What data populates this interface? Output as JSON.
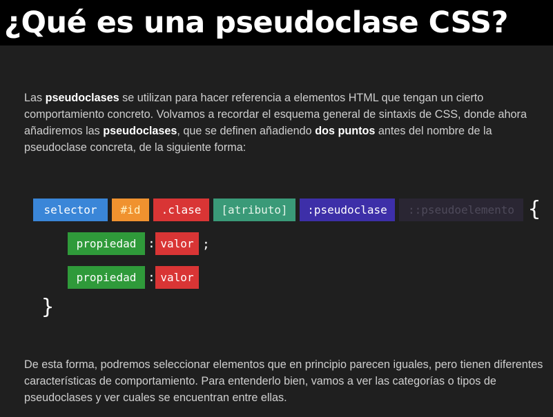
{
  "title": "¿Qué es una pseudoclase CSS?",
  "intro": {
    "t1": "Las ",
    "b1": "pseudoclases",
    "t2": " se utilizan para hacer referencia a elementos HTML que tengan un cierto comportamiento concreto. Volvamos a recordar el esquema general de sintaxis de CSS, donde ahora añadiremos las ",
    "b2": "pseudoclases",
    "t3": ", que se definen añadiendo ",
    "b3": "dos puntos",
    "t4": " antes del nombre de la pseudoclase concreta, de la siguiente forma:"
  },
  "syntax": {
    "tokens": {
      "selector": "selector",
      "id": "#id",
      "clase": ".clase",
      "atributo": "[atributo]",
      "pseudoclase": ":pseudoclase",
      "pseudoelemento": "::pseudoelemento"
    },
    "open_brace": "{",
    "close_brace": "}",
    "colon": ":",
    "semicolon": ";",
    "rules": [
      {
        "property": "propiedad",
        "value": "valor"
      },
      {
        "property": "propiedad",
        "value": "valor"
      }
    ]
  },
  "outro": "De esta forma, podremos seleccionar elementos que en principio parecen iguales, pero tienen diferentes características de comportamiento. Para entenderlo bien, vamos a ver las categorías o tipos de pseudoclases y ver cuales se encuentran entre ellas.",
  "colors": {
    "selector": "#3a86d8",
    "id": "#f0922f",
    "clase": "#d93535",
    "atributo": "#3a9a78",
    "pseudoclase": "#3d2fa8",
    "pseudoelemento": "#2a2633",
    "propiedad": "#2f9a3a",
    "valor": "#d93535"
  }
}
